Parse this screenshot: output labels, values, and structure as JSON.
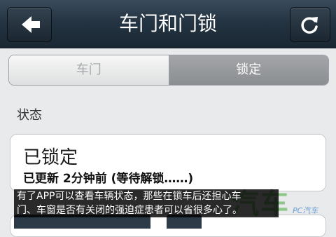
{
  "header": {
    "title": "车门和门锁",
    "back_icon": "arrow-left-icon",
    "refresh_icon": "refresh-icon"
  },
  "segmented": {
    "door_label": "车门",
    "lock_label": "锁定",
    "selected": "锁定"
  },
  "status": {
    "section_label": "状态",
    "main": "已锁定",
    "sub": "已更新 2分钟前 (等待解锁……)"
  },
  "overlay": {
    "caption_line1": "有了APP可以查看车辆状态，那些在锁车后还担心车",
    "caption_line2": "门、车窗是否有关闭的强迫症患者可以省很多心了。",
    "watermark_text": "汽车",
    "watermark_logo": "PC汽车"
  },
  "colors": {
    "header_bg": "#243442",
    "segment_selected": "#8b8e91",
    "watermark": "#46aa3c"
  }
}
